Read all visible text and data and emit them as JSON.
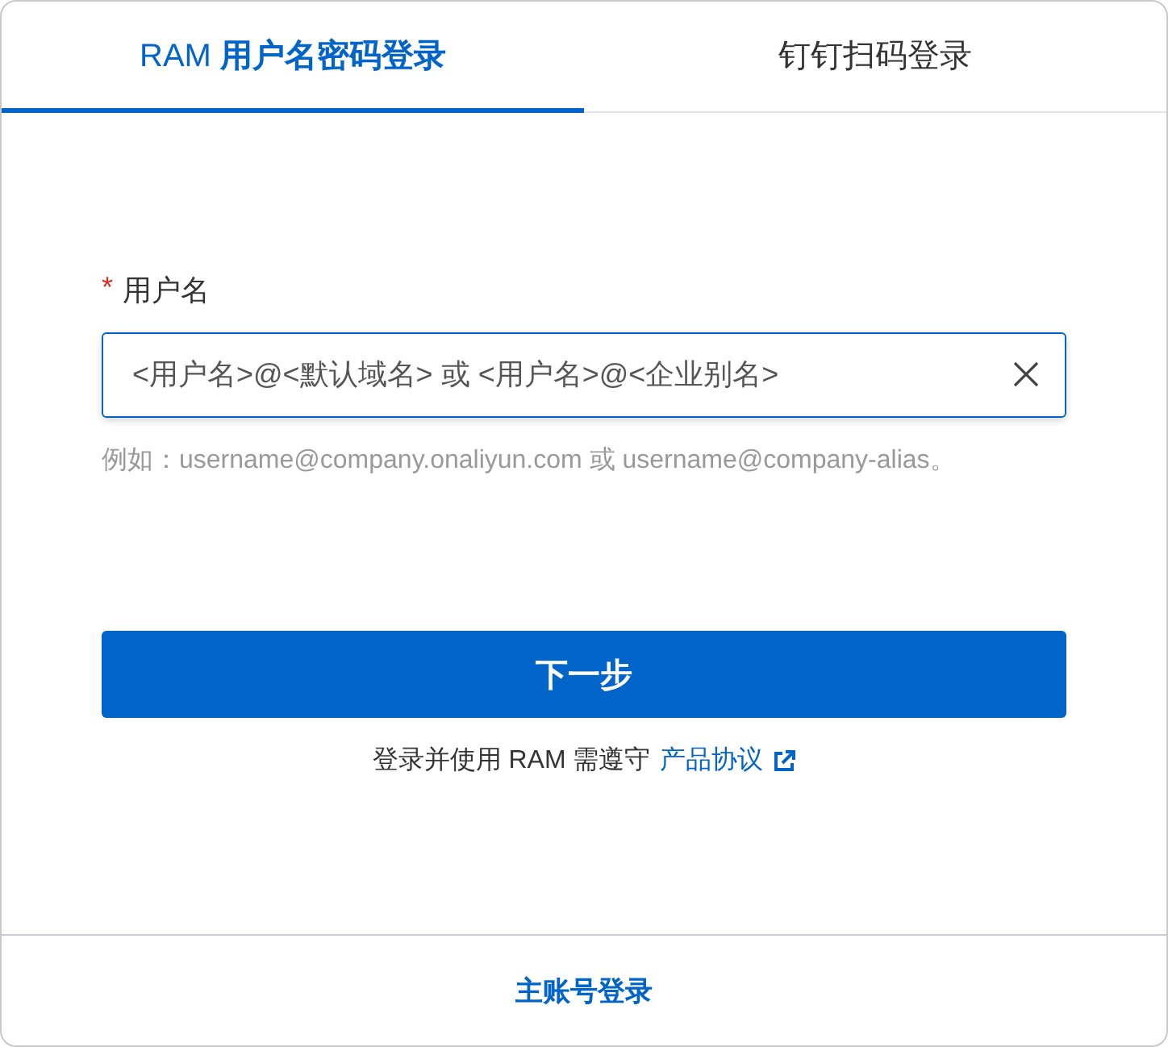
{
  "tabs": [
    {
      "label": "RAM **用户名密码登录**",
      "selected": true
    },
    {
      "label": "钉钉扫码登录",
      "selected": false
    }
  ],
  "form": {
    "required_mark": "*",
    "label": "用户名",
    "field": {
      "placeholder": "<用户名>@<默认域名> 或 <用户名>@<企业别名>",
      "focused": true,
      "clear_icon": true
    },
    "hint": "例如：username@company.onaliyun.com 或 username@company-alias。"
  },
  "next_button": "下一步",
  "agreement": {
    "text": "登录并使用 RAM 需遵守",
    "link": "产品协议"
  },
  "footer_link": "主账号登录"
}
